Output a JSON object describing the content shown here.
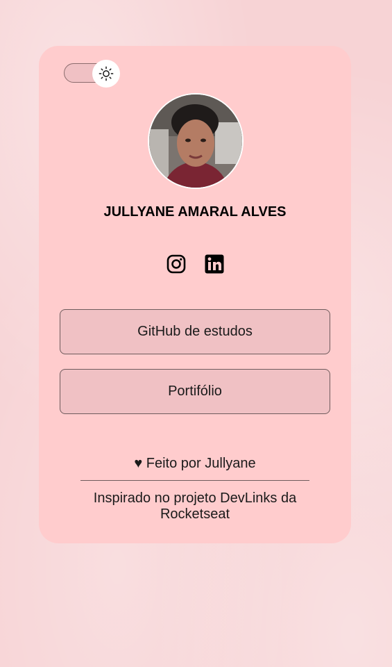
{
  "profile": {
    "name": "JULLYANE AMARAL ALVES"
  },
  "theme_toggle": {
    "icon": "sun-icon"
  },
  "social": {
    "icons": [
      "instagram-icon",
      "linkedin-icon"
    ]
  },
  "links": [
    {
      "label": "GitHub de estudos"
    },
    {
      "label": "Portifólio"
    }
  ],
  "footer": {
    "made_by": "♥ Feito por Jullyane",
    "inspired": "Inspirado no projeto DevLinks da Rocketseat"
  },
  "colors": {
    "card_bg": "#ffcccd",
    "button_bg": "#f0c1c4",
    "page_bg": "#f7d3d5"
  }
}
